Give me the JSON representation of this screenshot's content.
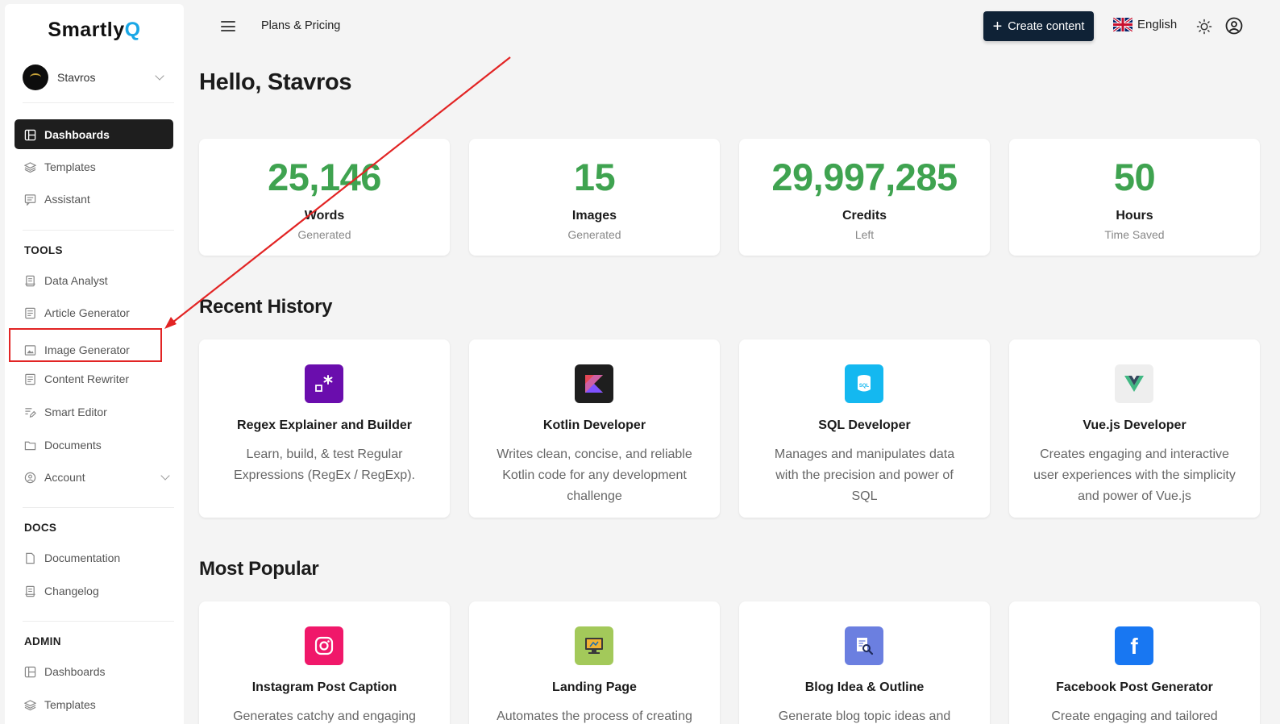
{
  "app": {
    "logo_main": "Smartly",
    "logo_accent": "Q"
  },
  "user": {
    "name": "Stavros"
  },
  "nav": {
    "main": [
      {
        "label": "Dashboards",
        "icon": "dashboard-icon"
      },
      {
        "label": "Templates",
        "icon": "layers-icon"
      },
      {
        "label": "Assistant",
        "icon": "chat-icon"
      }
    ],
    "tools_title": "TOOLS",
    "tools": [
      {
        "label": "Data Analyst",
        "icon": "file-icon"
      },
      {
        "label": "Article Generator",
        "icon": "document-icon"
      },
      {
        "label": "Image Generator",
        "icon": "image-icon"
      },
      {
        "label": "Content Rewriter",
        "icon": "document-icon"
      },
      {
        "label": "Smart Editor",
        "icon": "edit-icon"
      },
      {
        "label": "Documents",
        "icon": "folder-icon"
      },
      {
        "label": "Account",
        "icon": "user-circle-icon"
      }
    ],
    "docs_title": "DOCS",
    "docs": [
      {
        "label": "Documentation",
        "icon": "file-icon"
      },
      {
        "label": "Changelog",
        "icon": "file-icon"
      }
    ],
    "admin_title": "ADMIN",
    "admin": [
      {
        "label": "Dashboards",
        "icon": "dashboard-icon"
      },
      {
        "label": "Templates",
        "icon": "layers-icon"
      }
    ]
  },
  "header": {
    "plans_link": "Plans & Pricing",
    "create_button": "Create content",
    "language": "English"
  },
  "greeting": "Hello, Stavros",
  "stats": [
    {
      "value": "25,146",
      "label": "Words",
      "sub": "Generated"
    },
    {
      "value": "15",
      "label": "Images",
      "sub": "Generated"
    },
    {
      "value": "29,997,285",
      "label": "Credits",
      "sub": "Left"
    },
    {
      "value": "50",
      "label": "Hours",
      "sub": "Time Saved"
    }
  ],
  "recent_title": "Recent History",
  "recent": [
    {
      "title": "Regex Explainer and Builder",
      "desc": "Learn, build, & test Regular Expressions (RegEx / RegExp).",
      "icon": "regex-icon",
      "color": "#6a0dad"
    },
    {
      "title": "Kotlin Developer",
      "desc": "Writes clean, concise, and reliable Kotlin code for any development challenge",
      "icon": "kotlin-icon",
      "color": "#1e1e1e"
    },
    {
      "title": "SQL Developer",
      "desc": "Manages and manipulates data with the precision and power of SQL",
      "icon": "sql-icon",
      "color": "#14b8f0"
    },
    {
      "title": "Vue.js Developer",
      "desc": "Creates engaging and interactive user experiences with the simplicity and power of Vue.js",
      "icon": "vue-icon",
      "color": "#eeeeee"
    }
  ],
  "popular_title": "Most Popular",
  "popular": [
    {
      "title": "Instagram Post Caption",
      "desc": "Generates catchy and engaging",
      "icon": "instagram-icon",
      "color": "#f0186a"
    },
    {
      "title": "Landing Page",
      "desc": "Automates the process of creating",
      "icon": "monitor-icon",
      "color": "#a3c95a"
    },
    {
      "title": "Blog Idea & Outline",
      "desc": "Generate blog topic ideas and",
      "icon": "blog-search-icon",
      "color": "#6b7fe0"
    },
    {
      "title": "Facebook Post Generator",
      "desc": "Create engaging and tailored",
      "icon": "facebook-icon",
      "color": "#1877f2"
    }
  ]
}
